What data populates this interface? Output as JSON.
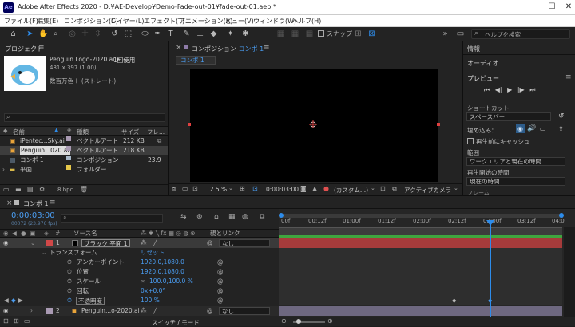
{
  "window": {
    "app_badge": "Ae",
    "title": "Adobe After Effects 2020 - D:¥AE-Develop¥Demo-Fade-out-01¥fade-out-01.aep *",
    "min": "─",
    "max": "☐",
    "close": "✕"
  },
  "menu": [
    "ファイル(F)",
    "編集(E)",
    "コンポジション(C)",
    "レイヤー(L)",
    "エフェクト(T)",
    "アニメーション(A)",
    "ビュー(V)",
    "ウィンドウ(W)",
    "ヘルプ(H)"
  ],
  "toolbar": {
    "snap_label": "スナップ",
    "search_placeholder": "ヘルプを検索",
    "more": "»"
  },
  "project": {
    "tab": "プロジェクト",
    "asset_name": "Penguin Logo-2020.ai ▾",
    "usage": "1回使用",
    "dims": "481 x 397 (1.00)",
    "color_depth": "数百万色＋ (ストレート)",
    "columns": {
      "name": "名前",
      "type": "種類",
      "size": "サイズ",
      "frame": "フレ..."
    },
    "items": [
      {
        "name": "iPentec...Sky.ai",
        "type": "ベクトルアート",
        "size": "212 KB",
        "frame": "",
        "color": "#a99ab3"
      },
      {
        "name": "Penguin...020.ai",
        "type": "ベクトルアート",
        "size": "218 KB",
        "frame": "",
        "color": "#a99ab3"
      },
      {
        "name": "コンポ 1",
        "type": "コンポジション",
        "size": "",
        "frame": "23.9",
        "color": "#a8b8c8"
      },
      {
        "name": "平面",
        "type": "フォルダー",
        "size": "",
        "frame": "",
        "color": "#e6c84a"
      }
    ],
    "bpc": "8 bpc"
  },
  "composition": {
    "tab_prefix": "コンポジション",
    "tab_name": "コンポ 1",
    "subtab": "コンポ 1",
    "zoom": "12.5 %",
    "timecode": "0:00:03:00",
    "channel": "(カスタム...)",
    "camera": "アクティブカメラ"
  },
  "right_panel": {
    "info": "情報",
    "audio": "オーディオ",
    "preview": "プレビュー",
    "shortcut_label": "ショートカット",
    "shortcut_value": "スペースバー",
    "embed_label": "埋め込み：",
    "cache_label": "再生前にキャッシュ",
    "range_label": "範囲",
    "range_value": "ワークエリアと現在の時間",
    "start_label": "再生開始の時間",
    "start_value": "現在の時間",
    "bottom_cut": "フレーム"
  },
  "timeline": {
    "tab": "コンポ 1",
    "timecode": "0:00:03:00",
    "frame_info": "00072 (23.976 fps)",
    "col_source": "ソース名",
    "col_parent": "親とリンク",
    "ruler": [
      "00f",
      "00:12f",
      "01:00f",
      "01:12f",
      "02:00f",
      "02:12f",
      "03:00f",
      "03:12f",
      "04:0"
    ],
    "layers": [
      {
        "num": "1",
        "name": "ブラック 平面 1",
        "parent": "なし",
        "color": "#d04848"
      },
      {
        "num": "2",
        "name": "Penguin...o-2020.ai",
        "parent": "なし",
        "color": "#a99ab3"
      }
    ],
    "transform": "トランスフォーム",
    "reset": "リセット",
    "props": [
      {
        "name": "アンカーポイント",
        "value": "1920.0,1080.0"
      },
      {
        "name": "位置",
        "value": "1920.0,1080.0"
      },
      {
        "name": "スケール",
        "value": "100.0,100.0 %"
      },
      {
        "name": "回転",
        "value": "0x+0.0°"
      },
      {
        "name": "不透明度",
        "value": "100 %"
      }
    ],
    "switches_label": "スイッチ / モード"
  }
}
